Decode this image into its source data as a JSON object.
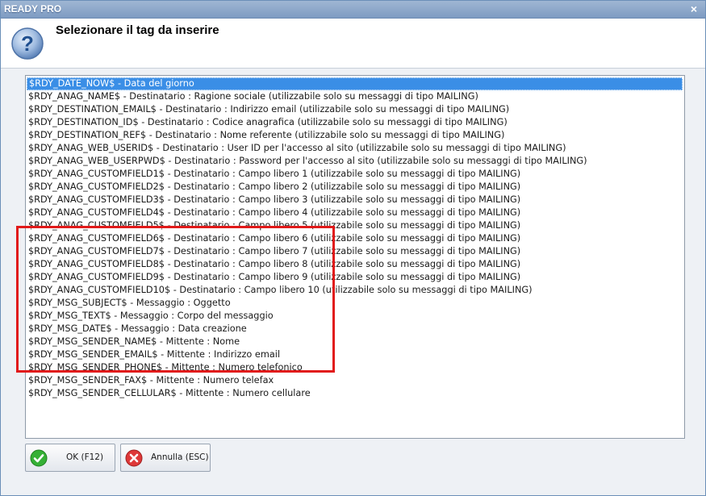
{
  "window": {
    "title": "READY PRO",
    "close_glyph": "×"
  },
  "header": {
    "heading": "Selezionare il tag da inserire",
    "icon": "question-icon"
  },
  "tags": [
    "$RDY_DATE_NOW$ - Data del giorno",
    "$RDY_ANAG_NAME$ - Destinatario : Ragione sociale (utilizzabile solo su messaggi di tipo MAILING)",
    "$RDY_DESTINATION_EMAIL$ - Destinatario : Indirizzo email (utilizzabile solo su messaggi di tipo MAILING)",
    "$RDY_DESTINATION_ID$ - Destinatario : Codice anagrafica (utilizzabile solo su messaggi di tipo MAILING)",
    "$RDY_DESTINATION_REF$ - Destinatario : Nome referente (utilizzabile solo su messaggi di tipo MAILING)",
    "$RDY_ANAG_WEB_USERID$ - Destinatario : User ID per l'accesso al sito (utilizzabile solo su messaggi di tipo MAILING)",
    "$RDY_ANAG_WEB_USERPWD$ - Destinatario : Password per l'accesso al sito (utilizzabile solo su messaggi di tipo MAILING)",
    "$RDY_ANAG_CUSTOMFIELD1$ - Destinatario : Campo libero 1 (utilizzabile solo su messaggi di tipo MAILING)",
    "$RDY_ANAG_CUSTOMFIELD2$ - Destinatario : Campo libero 2 (utilizzabile solo su messaggi di tipo MAILING)",
    "$RDY_ANAG_CUSTOMFIELD3$ - Destinatario : Campo libero 3 (utilizzabile solo su messaggi di tipo MAILING)",
    "$RDY_ANAG_CUSTOMFIELD4$ - Destinatario : Campo libero 4 (utilizzabile solo su messaggi di tipo MAILING)",
    "$RDY_ANAG_CUSTOMFIELD5$ - Destinatario : Campo libero 5 (utilizzabile solo su messaggi di tipo MAILING)",
    "$RDY_ANAG_CUSTOMFIELD6$ - Destinatario : Campo libero 6 (utilizzabile solo su messaggi di tipo MAILING)",
    "$RDY_ANAG_CUSTOMFIELD7$ - Destinatario : Campo libero 7 (utilizzabile solo su messaggi di tipo MAILING)",
    "$RDY_ANAG_CUSTOMFIELD8$ - Destinatario : Campo libero 8 (utilizzabile solo su messaggi di tipo MAILING)",
    "$RDY_ANAG_CUSTOMFIELD9$ - Destinatario : Campo libero 9 (utilizzabile solo su messaggi di tipo MAILING)",
    "$RDY_ANAG_CUSTOMFIELD10$ - Destinatario : Campo libero 10 (utilizzabile solo su messaggi di tipo MAILING)",
    "$RDY_MSG_SUBJECT$ - Messaggio : Oggetto",
    "$RDY_MSG_TEXT$ - Messaggio : Corpo del messaggio",
    "$RDY_MSG_DATE$ - Messaggio : Data creazione",
    "$RDY_MSG_SENDER_NAME$ - Mittente : Nome",
    "$RDY_MSG_SENDER_EMAIL$ - Mittente : Indirizzo email",
    "$RDY_MSG_SENDER_PHONE$ - Mittente : Numero telefonico",
    "$RDY_MSG_SENDER_FAX$ - Mittente : Numero telefax",
    "$RDY_MSG_SENDER_CELLULAR$ - Mittente : Numero cellulare"
  ],
  "selected_index": 0,
  "buttons": {
    "ok_label": "OK (F12)",
    "ok_icon": "checkmark-icon",
    "cancel_label": "Annulla (ESC)",
    "cancel_icon": "close-icon"
  },
  "colors": {
    "selection": "#3a8ee6",
    "annotation": "#e11a1a",
    "ok_icon": "#2fa82f",
    "cancel_icon": "#d93030"
  }
}
